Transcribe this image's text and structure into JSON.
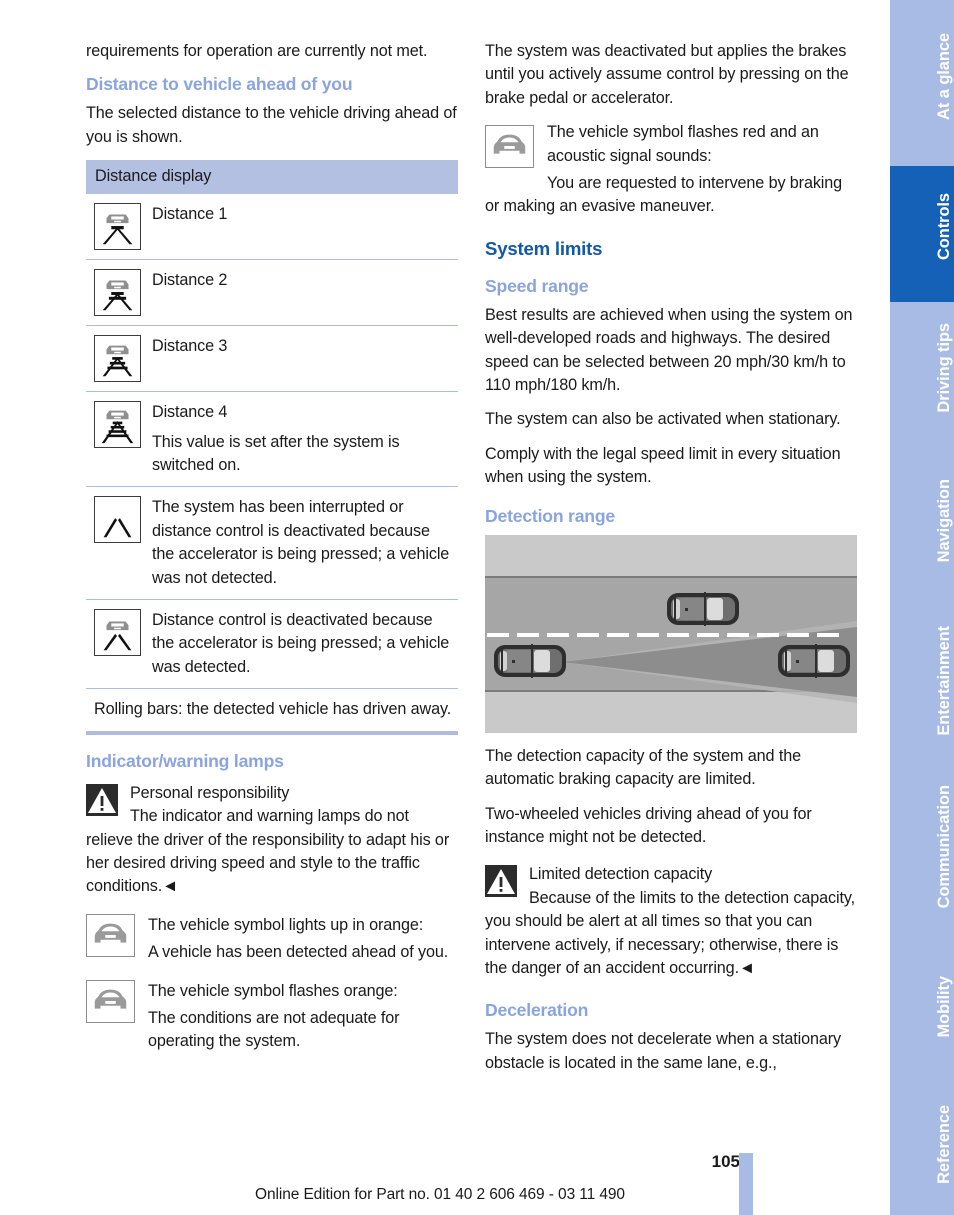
{
  "left_column": {
    "intro_paragraph": "requirements for operation are currently not met.",
    "heading_distance": "Distance to vehicle ahead of you",
    "distance_intro": "The selected distance to the vehicle driving ahead of you is shown.",
    "table": {
      "header": "Distance display",
      "rows": [
        {
          "icon": "distance-1-icon",
          "bars": 1,
          "has_car": true,
          "lines": [
            "Distance 1"
          ]
        },
        {
          "icon": "distance-2-icon",
          "bars": 2,
          "has_car": true,
          "lines": [
            "Distance 2"
          ]
        },
        {
          "icon": "distance-3-icon",
          "bars": 3,
          "has_car": true,
          "lines": [
            "Distance 3"
          ]
        },
        {
          "icon": "distance-4-icon",
          "bars": 4,
          "has_car": true,
          "lines": [
            "Distance 4",
            "This value is set after the system is switched on."
          ]
        },
        {
          "icon": "lane-only-icon",
          "bars": 0,
          "has_car": false,
          "lines": [
            "The system has been interrupted or distance control is deactivated because the accelerator is being pressed; a vehicle was not detected."
          ]
        },
        {
          "icon": "lane-with-car-icon",
          "bars": 0,
          "has_car": true,
          "lines": [
            "Distance control is deactivated because the accelerator is being pressed; a vehicle was detected."
          ]
        }
      ],
      "footer_note": "Rolling bars: the detected vehicle has driven away."
    },
    "heading_lamps": "Indicator/warning lamps",
    "warning": {
      "title": "Personal responsibility",
      "body": "The indicator and warning lamps do not relieve the driver of the responsibility to adapt his or her desired driving speed and style to the traffic conditions.◄"
    },
    "lamp_items": [
      {
        "icon": "vehicle-front-icon",
        "lines": [
          "The vehicle symbol lights up in orange:",
          "A vehicle has been detected ahead of you."
        ]
      },
      {
        "icon": "vehicle-front-icon",
        "lines": [
          "The vehicle symbol flashes orange:",
          "The conditions are not adequate for operating the system."
        ]
      }
    ]
  },
  "right_column": {
    "intro_paragraph": "The system was deactivated but applies the brakes until you actively assume control by pressing on the brake pedal or accelerator.",
    "lamp_red": {
      "icon": "vehicle-front-icon",
      "line1": "The vehicle symbol flashes red and an acoustic signal sounds:",
      "line2": "You are requested to intervene by braking or making an evasive maneuver."
    },
    "heading_system_limits": "System limits",
    "heading_speed_range": "Speed range",
    "speed_paragraphs": [
      "Best results are achieved when using the system on well-developed roads and highways. The desired speed can be selected between 20 mph/30 km/h to 110 mph/180 km/h.",
      "The system can also be activated when stationary.",
      "Comply with the legal speed limit in every situation when using the system."
    ],
    "heading_detection_range": "Detection range",
    "figure": {
      "name": "detection-range-diagram",
      "description": "Top-down highway view: ego vehicle lower-left emits a widening radar detection cone; one vehicle in the adjacent upper lane, one vehicle ahead in the same lane on the right"
    },
    "detection_paragraphs": [
      "The detection capacity of the system and the automatic braking capacity are limited.",
      "Two-wheeled vehicles driving ahead of you for instance might not be detected."
    ],
    "warning": {
      "title": "Limited detection capacity",
      "body": "Because of the limits to the detection capacity, you should be alert at all times so that you can intervene actively, if necessary; otherwise, there is the danger of an accident occurring.◄"
    },
    "heading_deceleration": "Deceleration",
    "deceleration_paragraph": "The system does not decelerate when a stationary obstacle is located in the same lane, e.g.,"
  },
  "rail": {
    "tabs": [
      {
        "label": "At a glance",
        "active": false
      },
      {
        "label": "Controls",
        "active": true
      },
      {
        "label": "Driving tips",
        "active": false
      },
      {
        "label": "Navigation",
        "active": false
      },
      {
        "label": "Entertainment",
        "active": false
      },
      {
        "label": "Communication",
        "active": false
      },
      {
        "label": "Mobility",
        "active": false
      },
      {
        "label": "Reference",
        "active": false
      }
    ]
  },
  "footer": {
    "page_number": "105",
    "edition_line": "Online Edition for Part no. 01 40 2 606 469 - 03 11 490"
  },
  "colors": {
    "section_heading": "#1359a8",
    "sub_heading": "#8aa4dd",
    "table_header_bg": "#b3c0e2",
    "rail_inactive": "#a7bbe4",
    "rail_active": "#1661b8",
    "rule": "#aebbdf"
  }
}
